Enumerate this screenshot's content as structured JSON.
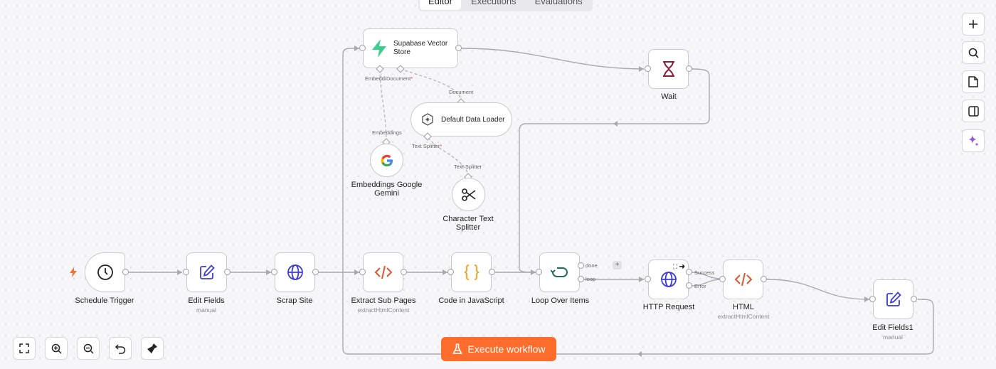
{
  "tabs": [
    {
      "label": "Editor",
      "active": true
    },
    {
      "label": "Executions",
      "active": false
    },
    {
      "label": "Evaluations",
      "active": false
    }
  ],
  "nodes": {
    "schedule": {
      "label": "Schedule Trigger",
      "icon": "clock-icon"
    },
    "edit_fields": {
      "label": "Edit Fields",
      "sub": "manual",
      "icon": "pencil-square-icon"
    },
    "scrap_site": {
      "label": "Scrap Site",
      "icon": "globe-icon"
    },
    "extract_sub_pages": {
      "label": "Extract Sub Pages",
      "sub": "extractHtmlContent",
      "icon": "code-icon"
    },
    "code_js": {
      "label": "Code in JavaScript",
      "icon": "braces-icon"
    },
    "loop": {
      "label": "Loop Over Items",
      "icon": "loop-icon",
      "out_done": "done",
      "out_loop": "loop"
    },
    "http": {
      "label": "HTTP Request",
      "icon": "globe-icon",
      "out_success": "Success",
      "out_error": "Error"
    },
    "html": {
      "label": "HTML",
      "sub": "extractHtmlContent",
      "icon": "code-icon"
    },
    "edit_fields1": {
      "label": "Edit Fields1",
      "sub": "manual",
      "icon": "pencil-square-icon"
    },
    "supabase": {
      "label": "Supabase Vector Store",
      "icon": "supabase-icon",
      "in_embedding": "Embeddi",
      "in_document": "Document"
    },
    "data_loader": {
      "label": "Default Data Loader",
      "icon": "loader-icon",
      "top_label": "Document",
      "in_splitter": "Text Splitter"
    },
    "gemini": {
      "label": "Embeddings Google Gemini",
      "icon": "google-icon",
      "top_label": "Embeddings"
    },
    "splitter": {
      "label": "Character Text Splitter",
      "icon": "scissors-icon",
      "top_label": "Text Splitter"
    },
    "wait": {
      "label": "Wait",
      "icon": "hourglass-icon"
    }
  },
  "execute_button": {
    "label": "Execute workflow",
    "icon": "flask-icon"
  },
  "right_toolbar": [
    "plus-icon",
    "search-icon",
    "sticky-note-icon",
    "panel-icon",
    "sparkle-icon"
  ],
  "bottom_toolbar": [
    "fit-view-icon",
    "zoom-in-icon",
    "zoom-out-icon",
    "undo-icon",
    "broom-icon"
  ],
  "colors": {
    "accent": "#ff6d2d",
    "code": "#e2552f",
    "braces": "#f5a524",
    "edit": "#3b3bd9",
    "globe": "#3b3bd9",
    "wait": "#8b1c3c",
    "loop": "#1f6e5a",
    "supabase": "#3ecf8e"
  }
}
